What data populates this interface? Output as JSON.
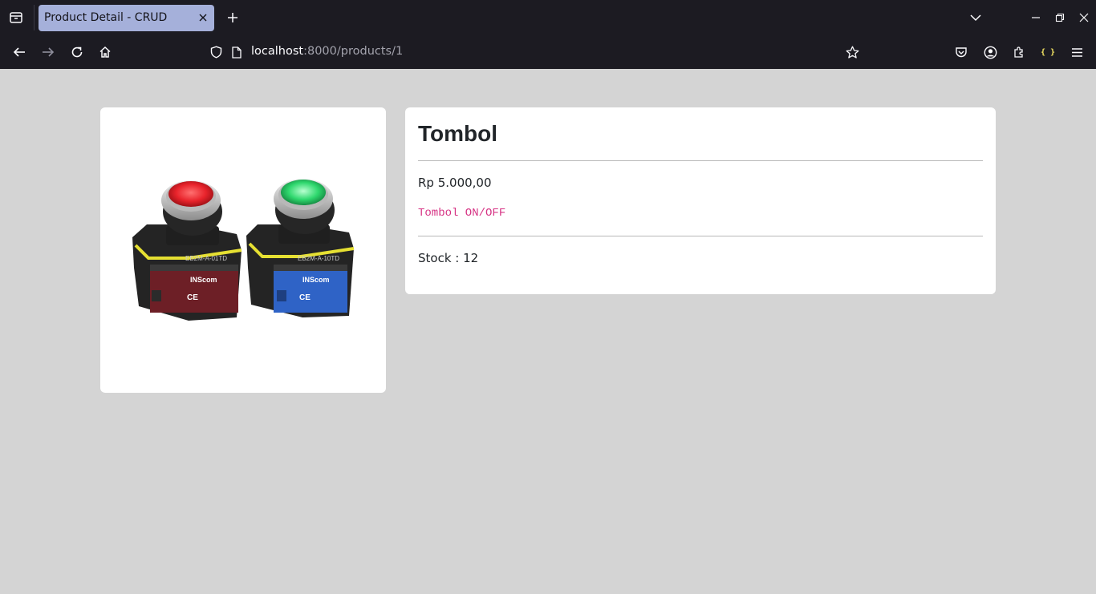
{
  "browser": {
    "tab_title": "Product Detail - CRUD",
    "url_host": "localhost",
    "url_rest": ":8000/products/1",
    "extension_badge": "{ }"
  },
  "product": {
    "name": "Tombol",
    "price": "Rp 5.000,00",
    "description": "Tombol ON/OFF",
    "stock_label": "Stock : ",
    "stock_value": "12",
    "image": {
      "left_module_label": "EB2M-A-01TD",
      "right_module_label": "EB2M-A-10TD",
      "brand": "INScom",
      "mark": "CE",
      "left_color": "#e8232b",
      "right_color": "#2fd86e"
    }
  },
  "colors": {
    "page_bg": "#d4d4d4",
    "chrome_bg": "#1c1b22",
    "tab_bg": "#a5b0da",
    "description_color": "#d63384"
  }
}
